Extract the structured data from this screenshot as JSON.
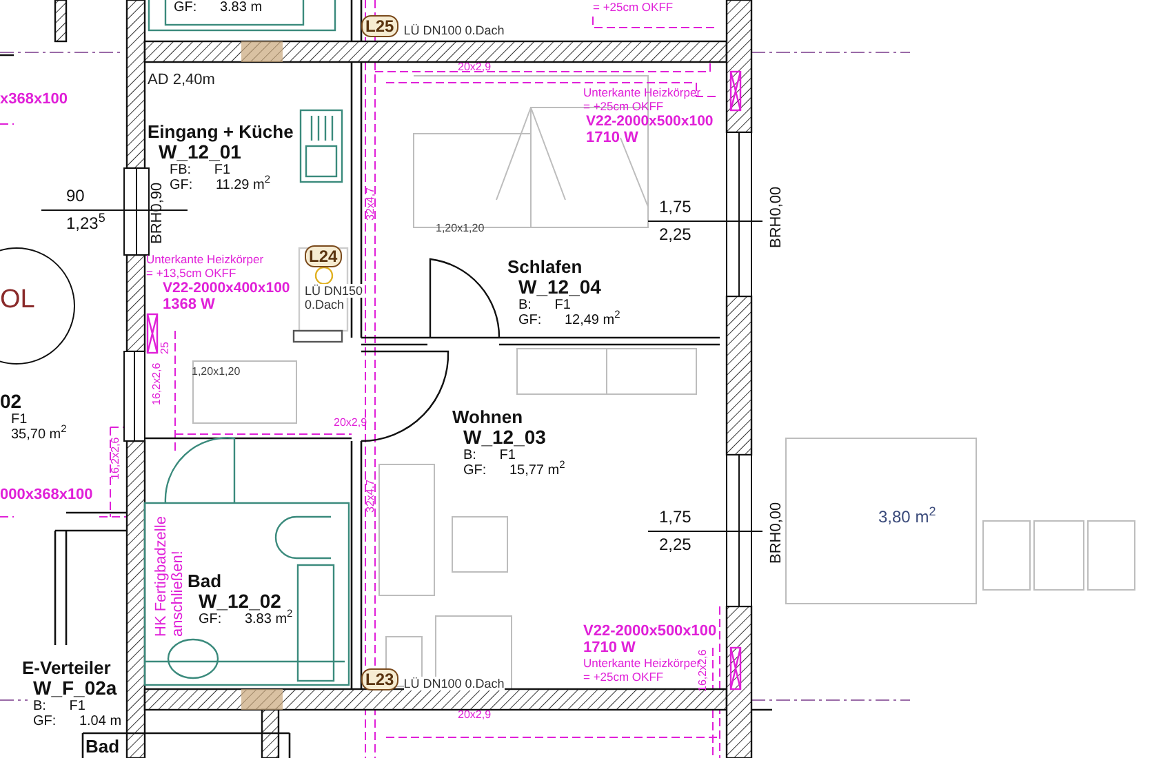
{
  "rooms": [
    {
      "name": "Eingang + Küche",
      "number": "W_12_01",
      "details": [
        {
          "label": "FB:",
          "value": "F1"
        },
        {
          "label": "GF:",
          "value": "11.29 m$^{2}$"
        }
      ]
    },
    {
      "name": "Schlafen",
      "number": "W_12_04",
      "details": [
        {
          "label": "B:",
          "value": "F1"
        },
        {
          "label": "GF:",
          "value": "12,49 m$^{2}$"
        }
      ]
    },
    {
      "name": "Wohnen",
      "number": "W_12_03",
      "details": [
        {
          "label": "B:",
          "value": "F1"
        },
        {
          "label": "GF:",
          "value": "15,77 m$^{2}$"
        }
      ]
    },
    {
      "name": "Bad",
      "number": "W_12_02",
      "details": [
        {
          "label": "GF:",
          "value": "3.83 m$^{2}$"
        }
      ]
    },
    {
      "number": "02",
      "details": [
        {
          "value": "F1"
        },
        {
          "value": "35,70 m$^{2}$"
        }
      ]
    },
    {
      "name": "E-Verteiler",
      "number": "W_F_02a",
      "details": [
        {
          "label": "B:",
          "value": "F1"
        },
        {
          "label": "GF:",
          "value": "1.04 m"
        }
      ]
    },
    {
      "name": "Bad"
    },
    {
      "details": [
        {
          "label": "GF:",
          "value": "3.83 m"
        }
      ]
    }
  ],
  "radiators": [
    {
      "note": [
        "Unterkante Heizkörper",
        "= +13,5cm OKFF"
      ],
      "model": "V22-2000x400x100",
      "power": "1368 W"
    },
    {
      "note": [
        "Unterkante Heizkörper",
        "= +25cm OKFF"
      ],
      "model": "V22-2000x500x100",
      "power": "1710 W"
    },
    {
      "note": [
        "Unterkante Heizkörper",
        "= +25cm OKFF"
      ],
      "model": "V22-2000x500x100",
      "power": "1710 W"
    }
  ],
  "partial_radiator_texts": [
    "x368x100",
    "000x368x100",
    "= +25cm OKFF"
  ],
  "vent_tags": [
    {
      "tag": "L25",
      "text": [
        "LÜ DN100 0.Dach"
      ]
    },
    {
      "tag": "L24",
      "text": [
        "LÜ DN150",
        "0.Dach"
      ]
    },
    {
      "tag": "L23",
      "text": [
        "LÜ DN100 0.Dach"
      ]
    }
  ],
  "window_dimensions": [
    {
      "above": "90",
      "below": "1,23$^{5}$"
    },
    {
      "above": "1,75",
      "below": "2,25"
    },
    {
      "above": "1,75",
      "below": "2,25"
    }
  ],
  "sill_heights": [
    "BRH0,90",
    "BRH0,00",
    "BRH0,00"
  ],
  "measurements": [
    {
      "text": "AD 2,40m",
      "kind": "height"
    },
    {
      "text": "1,20x1,20",
      "kind": "furniture"
    },
    {
      "text": "1,20x1,20",
      "kind": "furniture"
    },
    {
      "text": "20x2,9",
      "kind": "pipe"
    },
    {
      "text": "20x2,9",
      "kind": "pipe"
    },
    {
      "text": "20x2,9",
      "kind": "pipe"
    },
    {
      "text": "32x4,7",
      "kind": "pipe"
    },
    {
      "text": "32x4,7",
      "kind": "pipe"
    },
    {
      "text": "16,2x2,6",
      "kind": "pipe"
    },
    {
      "text": "16,2x2,6",
      "kind": "pipe"
    },
    {
      "text": "16,2x2,6",
      "kind": "pipe"
    },
    {
      "text": "25",
      "kind": "pipe"
    }
  ],
  "bathroom_note": [
    "HK Fertigbadzelle",
    "anschließen!"
  ],
  "symbol": "OL",
  "terrace": {
    "area": "3,80 m$^{2}$"
  }
}
